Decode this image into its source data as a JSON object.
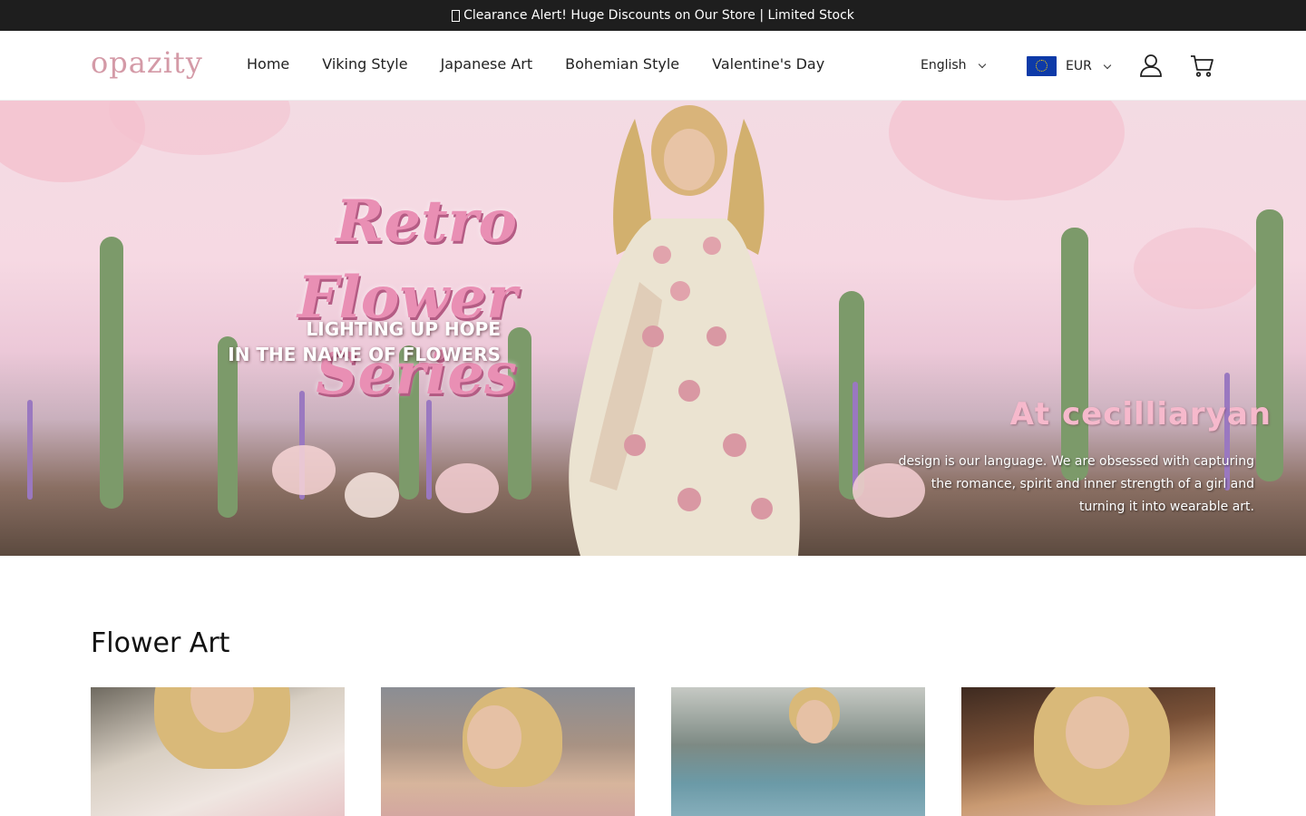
{
  "announcement": {
    "icon": "megaphone-icon",
    "text": "Clearance Alert! Huge Discounts on Our Store | Limited Stock"
  },
  "header": {
    "logo": "opazity",
    "nav": [
      "Home",
      "Viking Style",
      "Japanese Art",
      "Bohemian Style",
      "Valentine's Day"
    ],
    "language": "English",
    "currency": "EUR",
    "icons": {
      "language_chevron": "chevron-down-icon",
      "currency_flag": "eu-flag-icon",
      "currency_chevron": "chevron-down-icon",
      "account": "user-icon",
      "cart": "cart-icon"
    }
  },
  "hero": {
    "title_line1": "Retro Flower",
    "title_line2": "Series",
    "subtitle_line1": "LIGHTING UP HOPE",
    "subtitle_line2": "IN THE NAME OF FLOWERS",
    "brand": "At cecilliaryan",
    "copy_line1": "design is our language. We are obsessed with capturing",
    "copy_line2": "the romance, spirit and inner strength of a girl and",
    "copy_line3": "turning it into wearable art."
  },
  "section": {
    "title": "Flower Art"
  },
  "colors": {
    "announcement_bg": "#1e1e1e",
    "logo": "#d49aa7",
    "hero_title": "#e98fb4"
  }
}
